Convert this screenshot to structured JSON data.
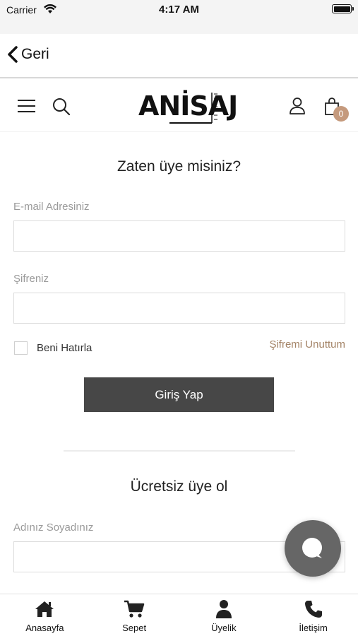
{
  "status_bar": {
    "carrier": "Carrier",
    "time": "4:17 AM"
  },
  "nav": {
    "back_label": "Geri"
  },
  "header": {
    "logo_text": "ANİSAJ",
    "cart_count": "0",
    "badge_color": "#c59a7d"
  },
  "login": {
    "title": "Zaten üye misiniz?",
    "email_label": "E-mail Adresiniz",
    "email_value": "",
    "password_label": "Şifreniz",
    "password_value": "",
    "remember_label": "Beni Hatırla",
    "forgot_label": "Şifremi Unuttum",
    "submit_label": "Giriş Yap"
  },
  "register": {
    "title": "Ücretsiz üye ol",
    "name_label": "Adınız Soyadınız",
    "name_value": ""
  },
  "tab_bar": {
    "items": [
      {
        "label": "Anasayfa",
        "icon": "home-icon"
      },
      {
        "label": "Sepet",
        "icon": "cart-icon"
      },
      {
        "label": "Üyelik",
        "icon": "user-icon"
      },
      {
        "label": "İletişim",
        "icon": "phone-icon"
      }
    ]
  },
  "colors": {
    "accent": "#a48467",
    "button": "#474747",
    "fab": "#666666"
  }
}
